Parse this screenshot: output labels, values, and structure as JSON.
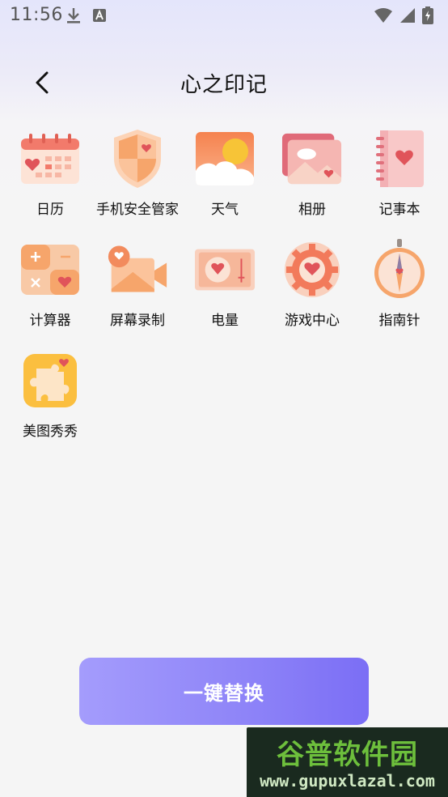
{
  "status_bar": {
    "time": "11:56",
    "icons_left": [
      "download-icon",
      "a-notification-icon"
    ],
    "icons_right": [
      "wifi-icon",
      "signal-icon",
      "battery-charging-icon"
    ]
  },
  "header": {
    "title": "心之印记",
    "back_icon": "chevron-left-icon"
  },
  "apps": [
    {
      "label": "日历",
      "icon": "calendar-icon"
    },
    {
      "label": "手机安全管家",
      "icon": "shield-icon"
    },
    {
      "label": "天气",
      "icon": "weather-icon"
    },
    {
      "label": "相册",
      "icon": "album-icon"
    },
    {
      "label": "记事本",
      "icon": "notebook-icon"
    },
    {
      "label": "计算器",
      "icon": "calculator-icon"
    },
    {
      "label": "屏幕录制",
      "icon": "screen-record-icon"
    },
    {
      "label": "电量",
      "icon": "battery-icon"
    },
    {
      "label": "游戏中心",
      "icon": "game-center-icon"
    },
    {
      "label": "指南针",
      "icon": "compass-icon"
    },
    {
      "label": "美图秀秀",
      "icon": "meitu-icon"
    }
  ],
  "action": {
    "replace_label": "一键替换"
  },
  "watermark": {
    "title": "谷普软件园",
    "url": "www.gupuxlazal.com"
  },
  "colors": {
    "accent_start": "#a49cfc",
    "accent_end": "#7b6ef5",
    "icon_orange": "#f6a56b",
    "heart_red": "#e0545a"
  }
}
